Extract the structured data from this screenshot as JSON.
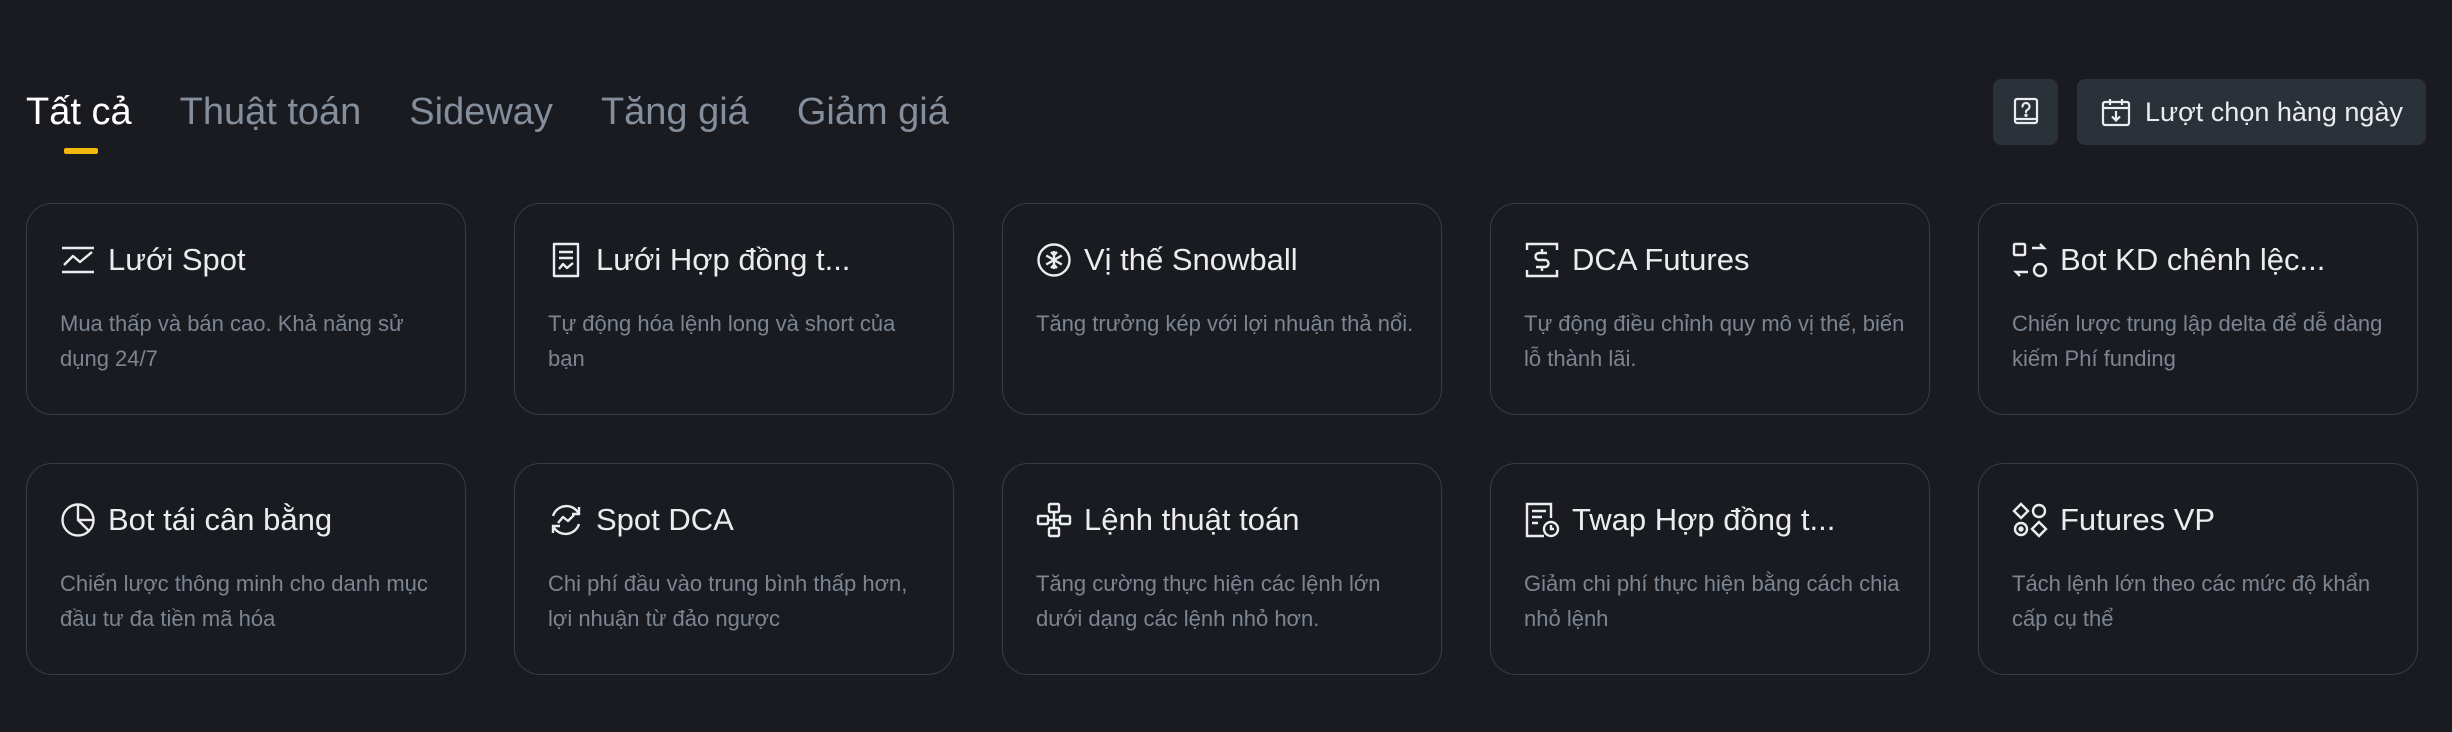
{
  "tabs": [
    {
      "label": "Tất cả",
      "active": true
    },
    {
      "label": "Thuật toán",
      "active": false
    },
    {
      "label": "Sideway",
      "active": false
    },
    {
      "label": "Tăng giá",
      "active": false
    },
    {
      "label": "Giảm giá",
      "active": false
    }
  ],
  "actions": {
    "help_icon": "help-book-icon",
    "daily_label": "Lượt chọn hàng ngày",
    "daily_icon": "calendar-download-icon"
  },
  "colors": {
    "background": "#1a1b20",
    "accent": "#f0b90b",
    "card_border": "#383c44",
    "button_bg": "#2b3139",
    "muted_text": "#7c8592"
  },
  "cards": [
    {
      "icon": "grid-chart-icon",
      "title": "Lưới Spot",
      "desc": "Mua thấp và bán cao. Khả năng sử dụng 24/7"
    },
    {
      "icon": "contract-document-icon",
      "title": "Lưới Hợp đồng t...",
      "desc": "Tự động hóa lệnh long và short của bạn"
    },
    {
      "icon": "snowball-icon",
      "title": "Vị thế Snowball",
      "desc": "Tăng trưởng kép với lợi nhuận thả nổi."
    },
    {
      "icon": "dollar-frame-icon",
      "title": "DCA Futures",
      "desc": "Tự động điều chỉnh quy mô vị thế, biến lỗ thành lãi."
    },
    {
      "icon": "arbitrage-icon",
      "title": "Bot KD chênh lệc...",
      "desc": "Chiến lược trung lập delta để dễ dàng kiếm Phí funding"
    },
    {
      "icon": "pie-chart-icon",
      "title": "Bot tái cân bằng",
      "desc": "Chiến lược thông minh cho danh mục đầu tư đa tiền mã hóa"
    },
    {
      "icon": "refresh-chart-icon",
      "title": "Spot DCA",
      "desc": "Chi phí đầu vào trung bình thấp hơn, lợi nhuận từ đảo ngược"
    },
    {
      "icon": "algorithm-nodes-icon",
      "title": "Lệnh thuật toán",
      "desc": "Tăng cường thực hiện các lệnh lớn dưới dạng các lệnh nhỏ hơn."
    },
    {
      "icon": "twap-clock-document-icon",
      "title": "Twap Hợp đồng t...",
      "desc": "Giảm chi phí thực hiện bằng cách chia nhỏ lệnh"
    },
    {
      "icon": "split-orders-icon",
      "title": "Futures VP",
      "desc": "Tách lệnh lớn theo các mức độ khẩn cấp cụ thể"
    }
  ]
}
